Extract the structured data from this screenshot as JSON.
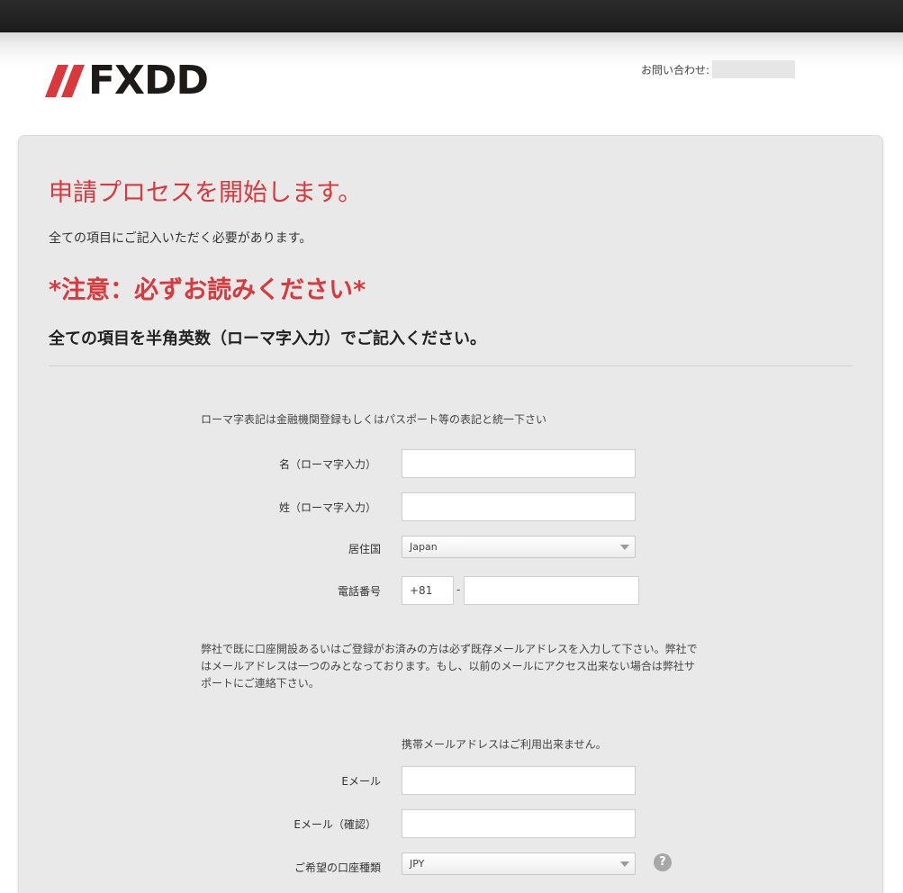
{
  "header": {
    "logo_text": "FXDD",
    "contact_label": "お問い合わせ:"
  },
  "page": {
    "title": "申請プロセスを開始します。",
    "lead": "全ての項目にご記入いただく必要があります。",
    "caution": "*注意：必ずお読みください*",
    "romaji_notice": "全ての項目を半角英数（ローマ字入力）でご記入ください。"
  },
  "form": {
    "romaji_note": "ローマ字表記は金融機関登録もしくはパスポート等の表記と統一下さい",
    "first_name_label": "名（ローマ字入力）",
    "last_name_label": "姓（ローマ字入力）",
    "country_label": "居住国",
    "country_value": "Japan",
    "phone_label": "電話番号",
    "phone_prefix": "+81",
    "phone_separator": "-",
    "email_note": "弊社で既に口座開設あるいはご登録がお済みの方は必ず既存メールアドレスを入力して下さい。弊社ではメールアドレスは一つのみとなっております。もし、以前のメールにアクセス出来ない場合は弊社サポートにご連絡下さい。",
    "mobile_note": "携帯メールアドレスはご利用出来ません。",
    "email_label": "Eメール",
    "email_confirm_label": "Eメール（確認）",
    "account_type_label": "ご希望の口座種類",
    "account_type_value": "JPY",
    "help_symbol": "?"
  },
  "colors": {
    "accent_red": "#d9383c",
    "panel_bg": "#e9e9e9"
  }
}
